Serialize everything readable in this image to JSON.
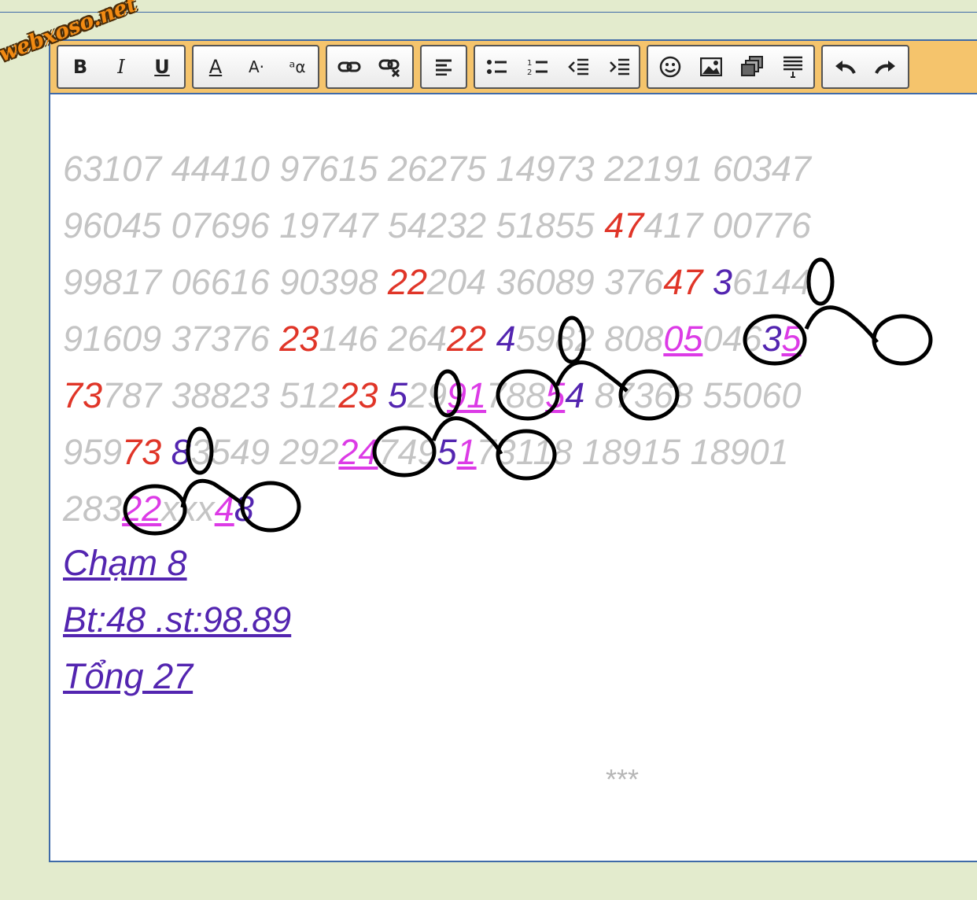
{
  "watermark": "webxoso.net",
  "toolbar": {
    "bold": "B",
    "italic": "I",
    "underline": "U",
    "font_color": "A",
    "font_size": "A·",
    "case": "ᵃα"
  },
  "icons": [
    "bold-icon",
    "italic-icon",
    "underline-icon",
    "font-color-icon",
    "font-size-icon",
    "change-case-icon",
    "link-icon",
    "unlink-icon",
    "align-left-icon",
    "bullet-list-icon",
    "numbered-list-icon",
    "outdent-icon",
    "indent-icon",
    "smiley-icon",
    "image-icon",
    "media-icon",
    "quote-icon",
    "undo-icon",
    "redo-icon"
  ],
  "rows": [
    [
      {
        "t": "63107 44410 97615 26275 14973 22191 60347",
        "c": "g"
      }
    ],
    [
      {
        "t": "96045 07696 19747 54232 51855 ",
        "c": "g"
      },
      {
        "t": "47",
        "c": "r"
      },
      {
        "t": "417 00776",
        "c": "g"
      }
    ],
    [
      {
        "t": "99817 06616 90398 ",
        "c": "g"
      },
      {
        "t": "22",
        "c": "r"
      },
      {
        "t": "204 36089 376",
        "c": "g"
      },
      {
        "t": "47",
        "c": "r"
      },
      {
        "t": " ",
        "c": "g"
      },
      {
        "t": "3",
        "c": "p"
      },
      {
        "t": "6144",
        "c": "g"
      }
    ],
    [
      {
        "t": "91609 37376 ",
        "c": "g"
      },
      {
        "t": "23",
        "c": "r"
      },
      {
        "t": "146 264",
        "c": "g"
      },
      {
        "t": "22",
        "c": "r"
      },
      {
        "t": " ",
        "c": "g"
      },
      {
        "t": "4",
        "c": "p"
      },
      {
        "t": "5982 808",
        "c": "g"
      },
      {
        "t": "05",
        "c": "k"
      },
      {
        "t": "046",
        "c": "g"
      },
      {
        "t": "3",
        "c": "p"
      },
      {
        "t": "5",
        "c": "k"
      }
    ],
    [
      {
        "t": "73",
        "c": "r"
      },
      {
        "t": "787 38823 512",
        "c": "g"
      },
      {
        "t": "23",
        "c": "r"
      },
      {
        "t": " ",
        "c": "g"
      },
      {
        "t": "5",
        "c": "p"
      },
      {
        "t": "29",
        "c": "g"
      },
      {
        "t": "91",
        "c": "k"
      },
      {
        "t": "788",
        "c": "g"
      },
      {
        "t": "5",
        "c": "k"
      },
      {
        "t": "4",
        "c": "p"
      },
      {
        "t": " 87368 55060",
        "c": "g"
      }
    ],
    [
      {
        "t": "959",
        "c": "g"
      },
      {
        "t": "73",
        "c": "r"
      },
      {
        "t": " ",
        "c": "g"
      },
      {
        "t": "8",
        "c": "p"
      },
      {
        "t": "3549 292",
        "c": "g"
      },
      {
        "t": "24",
        "c": "k"
      },
      {
        "t": "749",
        "c": "g"
      },
      {
        "t": "5",
        "c": "p"
      },
      {
        "t": "1",
        "c": "k"
      },
      {
        "t": "73118 18915 18901",
        "c": "g"
      }
    ],
    [
      {
        "t": "283",
        "c": "g"
      },
      {
        "t": "22",
        "c": "k"
      },
      {
        "t": "xxx",
        "c": "g"
      },
      {
        "t": "4",
        "c": "k"
      },
      {
        "t": "8",
        "c": "p"
      }
    ]
  ],
  "notes": {
    "cham": "Chạm 8",
    "bt": "Bt:48 .st:98.89",
    "tong": "Tổng 27"
  },
  "footer": "***",
  "colors": {
    "gray": "#c4c4c4",
    "red": "#e03528",
    "purple": "#5325b0",
    "pink": "#dc3be6",
    "toolbar": "#f5c46c",
    "frame": "#3f6aa8"
  }
}
